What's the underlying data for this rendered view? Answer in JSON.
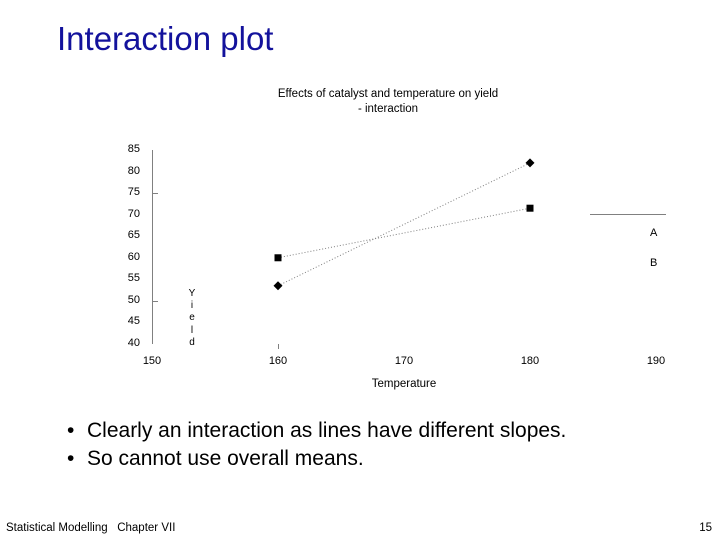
{
  "slide": {
    "title": "Interaction plot",
    "title_color": "#13129c"
  },
  "chart_data": {
    "type": "line",
    "title": "Effects of catalyst and temperature on yield",
    "subtitle": "- interaction",
    "xlabel": "Temperature",
    "ylabel": "Yield",
    "x": [
      160,
      180
    ],
    "xlim": [
      150,
      190
    ],
    "ylim": [
      40,
      85
    ],
    "xticks": [
      150,
      160,
      170,
      180,
      190
    ],
    "yticks": [
      85,
      80,
      75,
      70,
      65,
      60,
      55,
      50,
      45,
      40
    ],
    "grid": false,
    "legend_position": "right",
    "line_style": "dotted",
    "line_color": "#808080",
    "marker_color": "#000000",
    "series": [
      {
        "name": "A",
        "marker": "square",
        "values": [
          60,
          71.5
        ]
      },
      {
        "name": "B",
        "marker": "diamond",
        "values": [
          53.5,
          82
        ]
      }
    ],
    "legend": [
      {
        "label": "A",
        "marker": "square"
      },
      {
        "label": "B",
        "marker": "diamond"
      }
    ]
  },
  "bullets": [
    {
      "marker": "•",
      "text": "Clearly an interaction as lines have different slopes."
    },
    {
      "marker": "•",
      "text": "So cannot use overall means."
    }
  ],
  "footer": {
    "left": "Statistical Modelling   Chapter VII",
    "page": "15"
  }
}
